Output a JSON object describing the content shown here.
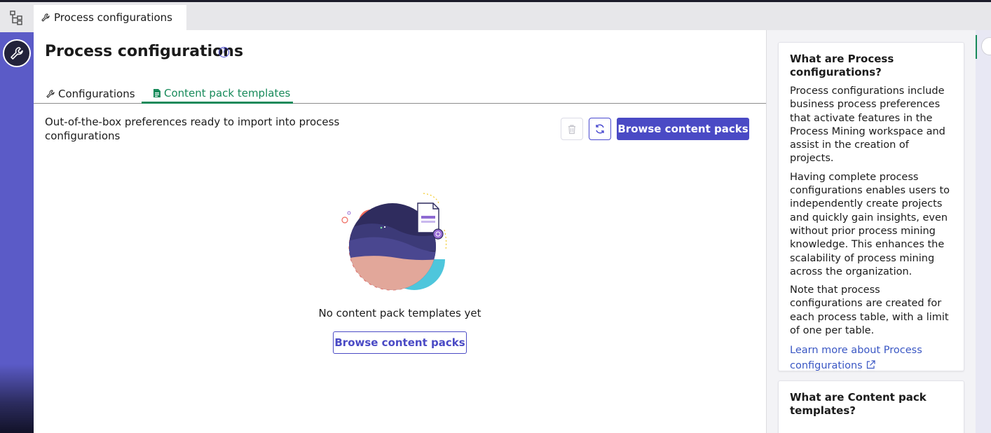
{
  "window": {
    "tab_title": "Process configurations"
  },
  "icons": {
    "rail_top": "hierarchy-icon",
    "rail_tool": "wrench-icon",
    "help": "help-circle-icon",
    "delete": "trash-icon",
    "refresh": "refresh-icon",
    "external": "external-link-icon",
    "content_tab": "document-icon"
  },
  "header": {
    "title": "Process configurations",
    "help_glyph": "?"
  },
  "tabs": [
    {
      "label": "Configurations",
      "active": false
    },
    {
      "label": "Content pack templates",
      "active": true
    }
  ],
  "content": {
    "description": "Out-of-the-box preferences ready to import into process configurations",
    "browse_button": "Browse content packs",
    "empty_text": "No content pack templates yet",
    "empty_browse_button": "Browse content packs"
  },
  "side": {
    "card1": {
      "title": "What are Process configurations?",
      "p1": "Process configurations include business process preferences that activate features in the Process Mining workspace and assist in the creation of projects.",
      "p2": "Having complete process configurations enables users to independently create projects and quickly gain insights, even without prior process mining knowledge. This enhances the scalability of process mining across the organization.",
      "p3": "Note that process configurations are created for each process table, with a limit of one per table.",
      "link": "Learn more about Process configurations"
    },
    "card2": {
      "title": "What are Content pack templates?"
    }
  },
  "colors": {
    "accent": "#4a4ac5",
    "active_tab": "#178a5a",
    "rail": "#5b5bc7",
    "link": "#3a57c4"
  }
}
